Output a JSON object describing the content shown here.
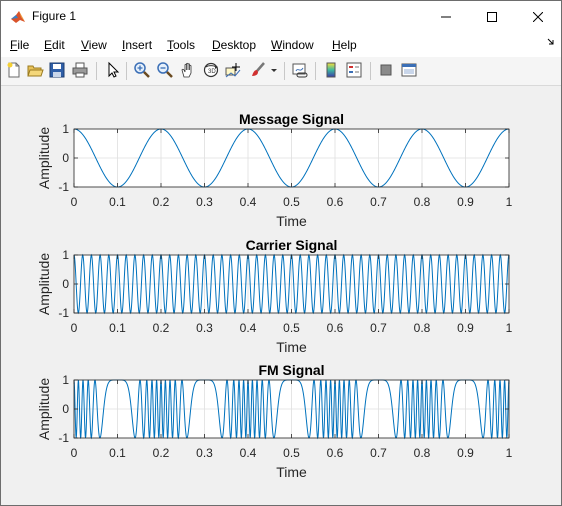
{
  "window": {
    "title": "Figure 1"
  },
  "menu": {
    "file": "File",
    "edit": "Edit",
    "view": "View",
    "insert": "Insert",
    "tools": "Tools",
    "desktop": "Desktop",
    "window": "Window",
    "help": "Help"
  },
  "toolbar_icons": [
    "new-figure-icon",
    "open-icon",
    "save-icon",
    "print-icon",
    "pointer-icon",
    "zoom-in-icon",
    "zoom-out-icon",
    "pan-icon",
    "rotate-icon",
    "data-cursor-icon",
    "brush-icon",
    "link-plot-icon",
    "colorbar-icon",
    "legend-icon",
    "hide-plot-tools-icon",
    "show-plot-tools-icon"
  ],
  "colors": {
    "line": "#0072bd",
    "axes_bg": "#ffffff",
    "figure_bg": "#f0f0f0",
    "grid": "#dfdfdf"
  },
  "chart_data": [
    {
      "type": "line",
      "title": "Message Signal",
      "xlabel": "Time",
      "ylabel": "Amplitude",
      "xlim": [
        0,
        1
      ],
      "ylim": [
        -1,
        1
      ],
      "grid": true,
      "xticks": [
        "0",
        "0.1",
        "0.2",
        "0.3",
        "0.4",
        "0.5",
        "0.6",
        "0.7",
        "0.8",
        "0.9",
        "1"
      ],
      "yticks": [
        "-1",
        "0",
        "1"
      ],
      "series": [
        {
          "function": "cos(2*pi*5*t)",
          "frequency_hz": 5
        }
      ]
    },
    {
      "type": "line",
      "title": "Carrier Signal",
      "xlabel": "Time",
      "ylabel": "Amplitude",
      "xlim": [
        0,
        1
      ],
      "ylim": [
        -1,
        1
      ],
      "grid": true,
      "xticks": [
        "0",
        "0.1",
        "0.2",
        "0.3",
        "0.4",
        "0.5",
        "0.6",
        "0.7",
        "0.8",
        "0.9",
        "1"
      ],
      "yticks": [
        "-1",
        "0",
        "1"
      ],
      "series": [
        {
          "function": "cos(2*pi*50*t)",
          "frequency_hz": 50
        }
      ]
    },
    {
      "type": "line",
      "title": "FM Signal",
      "xlabel": "Time",
      "ylabel": "Amplitude",
      "xlim": [
        0,
        1
      ],
      "ylim": [
        -1,
        1
      ],
      "grid": true,
      "xticks": [
        "0",
        "0.1",
        "0.2",
        "0.3",
        "0.4",
        "0.5",
        "0.6",
        "0.7",
        "0.8",
        "0.9",
        "1"
      ],
      "yticks": [
        "-1",
        "0",
        "1"
      ],
      "series": [
        {
          "function": "cos(2*pi*50*t + 10*sin(2*pi*5*t))",
          "carrier_hz": 50,
          "message_hz": 5,
          "modulation_index": 10
        }
      ]
    }
  ]
}
